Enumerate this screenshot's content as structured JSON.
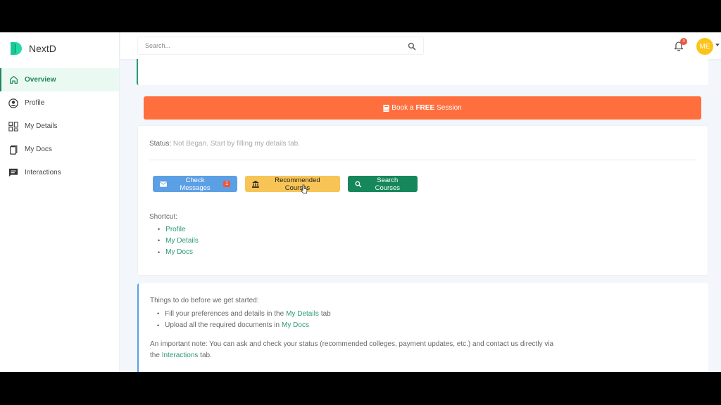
{
  "brand": {
    "name": "NextD"
  },
  "sidebar": {
    "items": [
      {
        "label": "Overview",
        "icon": "home-icon",
        "active": true
      },
      {
        "label": "Profile",
        "icon": "user-circle-icon",
        "active": false
      },
      {
        "label": "My Details",
        "icon": "grid-icon",
        "active": false
      },
      {
        "label": "My Docs",
        "icon": "docs-icon",
        "active": false
      },
      {
        "label": "Interactions",
        "icon": "chat-icon",
        "active": false
      }
    ]
  },
  "topbar": {
    "search_placeholder": "Search...",
    "notification_count": "3",
    "avatar_initials": "ME"
  },
  "book_button": {
    "prefix": "Book a",
    "bold": "FREE",
    "suffix": "Session",
    "color": "#ff6f3d"
  },
  "status": {
    "label": "Status:",
    "value": "Not Began. Start by filling my details tab."
  },
  "actions": {
    "check_messages": "Check Messages",
    "messages_count": "1",
    "recommended_courses": "Recommended Courses",
    "search_courses": "Search Courses"
  },
  "shortcut": {
    "title": "Shortcut:",
    "links": [
      "Profile",
      "My Details",
      "My Docs"
    ]
  },
  "info": {
    "heading": "Things to do before we get started:",
    "items": [
      {
        "before": "Fill your preferences and details in the",
        "link": "My Details",
        "after": "tab"
      },
      {
        "before": "Upload all the required documents in",
        "link": "My Docs",
        "after": ""
      }
    ],
    "note_before": "An important note: You can ask and check your status (recommended colleges, payment updates, etc.) and contact us directly via the",
    "note_link": "Interactions",
    "note_after": "tab."
  },
  "colors": {
    "accent": "#2b9a70",
    "primary_blue": "#5b9fe5",
    "warning": "#f7c455",
    "success": "#15875a",
    "danger": "#e9583e"
  }
}
